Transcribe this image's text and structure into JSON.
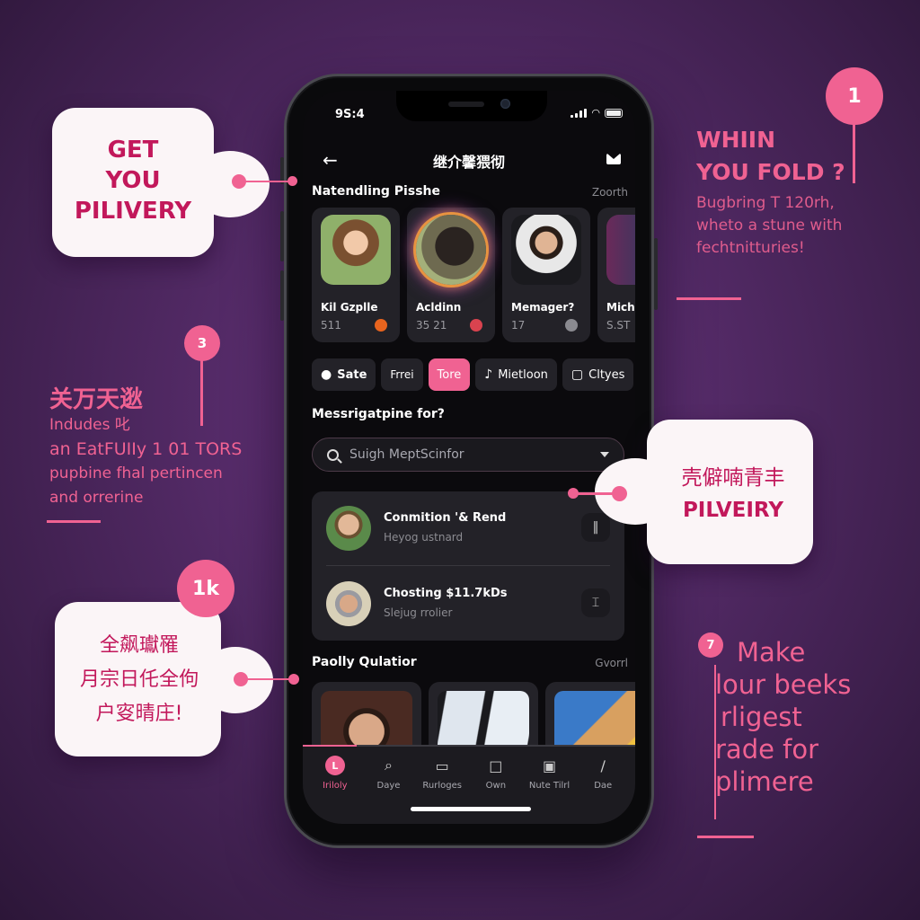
{
  "colors": {
    "accent": "#f06292",
    "callout_text": "#c2185b",
    "background": "#532a66",
    "screen_bg": "#0b0a0d",
    "card_bg": "#232228"
  },
  "phone": {
    "status_bar": {
      "time": "9S:4",
      "icons": [
        "signal-icon",
        "wifi-icon",
        "battery-icon"
      ]
    },
    "top_bar": {
      "back_icon": "arrow-left-icon",
      "title": "继介馨猥彻",
      "action_icon": "mail-icon"
    },
    "trending": {
      "title": "Natendling Pisshe",
      "link": "Zoorth",
      "profiles": [
        {
          "name": "Kil Gzplle",
          "count": "511",
          "badge_color": "#e8641e"
        },
        {
          "name": "Acldinn",
          "count": "35 21",
          "badge_color": "#d9434f"
        },
        {
          "name": "Memager?",
          "count": "17",
          "badge_color": "#8a8a90"
        },
        {
          "name": "Micho",
          "count": "S.ST",
          "badge_color": ""
        }
      ]
    },
    "chips": [
      {
        "label": "Sate",
        "icon": "apple-icon",
        "active": false
      },
      {
        "label": "Frrei",
        "icon": "",
        "active": false
      },
      {
        "label": "Tore",
        "icon": "",
        "active": true
      },
      {
        "label": "Mietloon",
        "icon": "music-note-icon",
        "active": false
      },
      {
        "label": "Cltyes",
        "icon": "calendar-icon",
        "active": false
      }
    ],
    "question": "Messrigatpine for?",
    "search": {
      "placeholder": "Suigh MeptScinfor"
    },
    "chats": [
      {
        "name": "Conmition '& Rend",
        "subtitle": "Heyog ustnard",
        "action_icon": "pause-icon"
      },
      {
        "name": "Chosting $11.7kDs",
        "subtitle": "Slejug rrolier",
        "action_icon": "text-cursor-icon"
      }
    ],
    "popular": {
      "title": "Paolly Qulatior",
      "link": "Gvorrl"
    },
    "bottom_nav": [
      {
        "label": "Iriloly",
        "icon": "profile-icon",
        "icon_letter": "L",
        "active": true
      },
      {
        "label": "Daye",
        "icon": "search-icon",
        "active": false
      },
      {
        "label": "Rurloges",
        "icon": "wallet-icon",
        "active": false
      },
      {
        "label": "Own",
        "icon": "bag-icon",
        "active": false
      },
      {
        "label": "Nute Tilrl",
        "icon": "save-icon",
        "active": false
      },
      {
        "label": "Dae",
        "icon": "microphone-icon",
        "active": false
      }
    ]
  },
  "callouts": {
    "top_left": {
      "lines": [
        "GET",
        "YOU",
        "PILIVERY"
      ]
    },
    "top_right": {
      "number": "1",
      "heading": [
        "WHIIN",
        "YOU FOLD ?"
      ],
      "body": [
        "Bugbring T 120rh,",
        "wheto a stune with",
        "fechtnitturies!"
      ]
    },
    "mid_left": {
      "number": "3",
      "heading": "关万天逖",
      "body": [
        "Indudes 叱",
        "an EatFUIIy 1 01 TORS",
        "pupbine fhal pertincen",
        "and orrerine"
      ]
    },
    "mid_right": {
      "lines": [
        "壳僻喃青丰",
        "PILVEIRY"
      ]
    },
    "bottom_left": {
      "badge": "1k",
      "lines": [
        "全飙瓛罹",
        "月宗日仛全佝",
        "户叜晴庄!"
      ]
    },
    "bottom_right": {
      "number": "7",
      "lines": [
        "Make",
        "lour beeks",
        "rligest",
        "rade for",
        "plimere"
      ]
    }
  }
}
